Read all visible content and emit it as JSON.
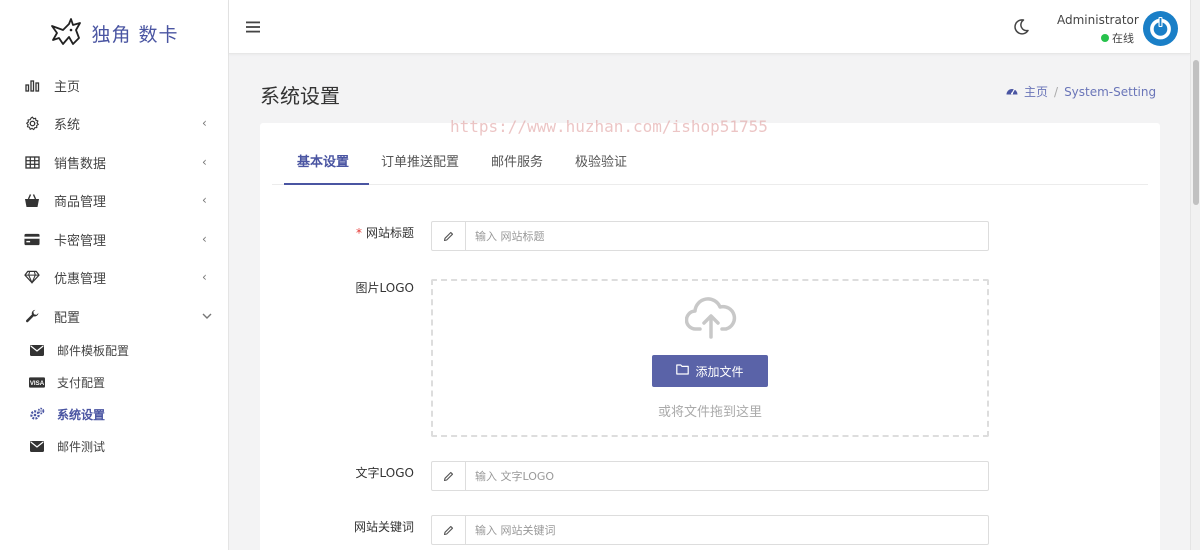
{
  "brand": {
    "name": "独角 数卡"
  },
  "sidebar": {
    "items": [
      {
        "label": "主页",
        "icon": "bar-chart-icon",
        "has_arrow": false
      },
      {
        "label": "系统",
        "icon": "gear-icon",
        "has_arrow": true,
        "arrow": "‹"
      },
      {
        "label": "销售数据",
        "icon": "table-icon",
        "has_arrow": true,
        "arrow": "‹"
      },
      {
        "label": "商品管理",
        "icon": "shopping-bag-icon",
        "has_arrow": true,
        "arrow": "‹"
      },
      {
        "label": "卡密管理",
        "icon": "credit-card-icon",
        "has_arrow": true,
        "arrow": "‹"
      },
      {
        "label": "优惠管理",
        "icon": "diamond-icon",
        "has_arrow": true,
        "arrow": "‹"
      },
      {
        "label": "配置",
        "icon": "wrench-icon",
        "has_arrow": true,
        "arrow": "⌄"
      }
    ],
    "sub_items": [
      {
        "label": "邮件模板配置",
        "icon": "envelope-icon",
        "active": false
      },
      {
        "label": "支付配置",
        "icon": "visa-card-icon",
        "active": false
      },
      {
        "label": "系统设置",
        "icon": "cogs-icon",
        "active": true
      },
      {
        "label": "邮件测试",
        "icon": "envelope-icon",
        "active": false
      }
    ]
  },
  "header": {
    "user_name": "Administrator",
    "status": "在线"
  },
  "page": {
    "title": "系统设置",
    "breadcrumb": {
      "home": "主页",
      "separator": "/",
      "current": "System-Setting"
    },
    "watermark": "https://www.huzhan.com/ishop51755"
  },
  "tabs": [
    {
      "label": "基本设置",
      "active": true
    },
    {
      "label": "订单推送配置",
      "active": false
    },
    {
      "label": "邮件服务",
      "active": false
    },
    {
      "label": "极验验证",
      "active": false
    }
  ],
  "form": {
    "site_title": {
      "label": "网站标题",
      "required_mark": "*",
      "placeholder": "输入 网站标题",
      "value": ""
    },
    "logo_image": {
      "label": "图片LOGO",
      "button": "添加文件",
      "hint": "或将文件拖到这里"
    },
    "text_logo": {
      "label": "文字LOGO",
      "placeholder": "输入 文字LOGO",
      "value": ""
    },
    "keywords": {
      "label": "网站关键词",
      "placeholder": "输入 网站关键词",
      "value": ""
    }
  },
  "colors": {
    "accent": "#4a55a2",
    "button": "#5a63a8",
    "online": "#27c24c",
    "avatar": "#1a7fc7"
  }
}
